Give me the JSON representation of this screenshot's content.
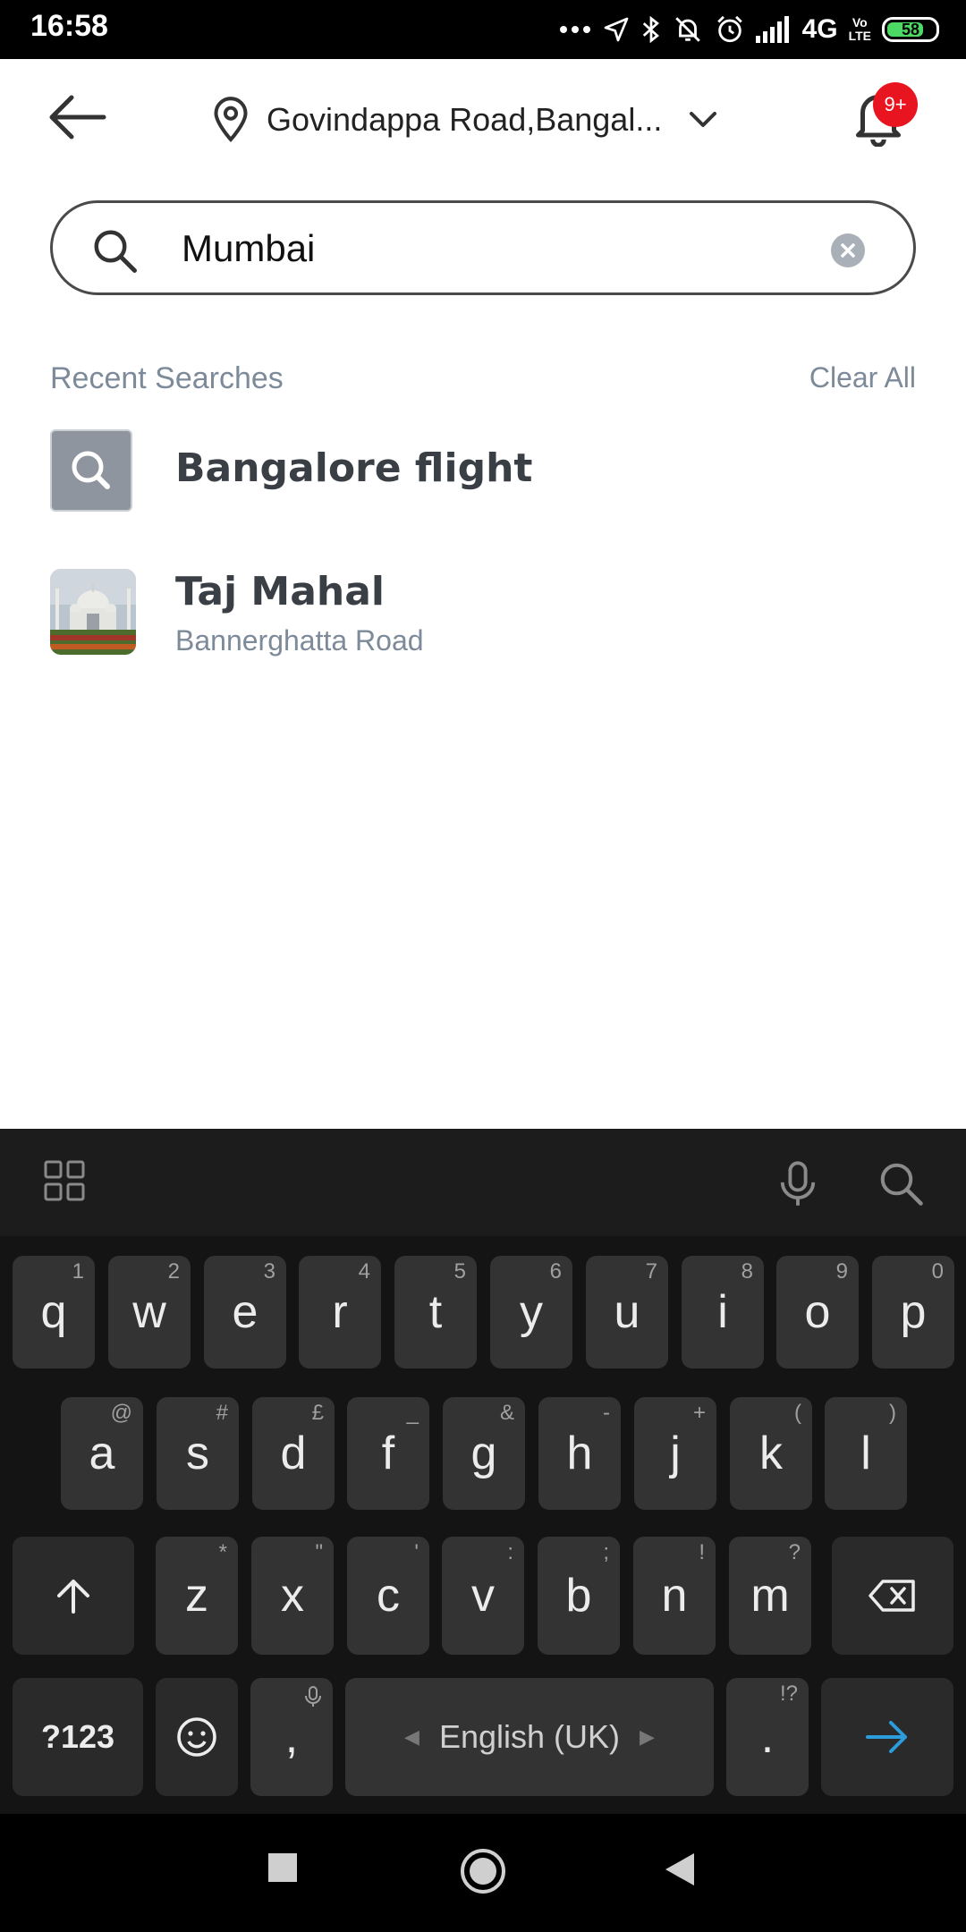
{
  "status_bar": {
    "time": "16:58",
    "network": "4G",
    "volte_top": "Vo",
    "volte_bottom": "LTE",
    "battery": "58"
  },
  "header": {
    "location": "Govindappa Road,Bangal...",
    "notification_badge": "9+"
  },
  "search": {
    "value": "Mumbai",
    "placeholder": ""
  },
  "recent": {
    "title": "Recent Searches",
    "clear_all": "Clear All",
    "items": [
      {
        "title": "Bangalore flight",
        "icon": "search-icon"
      },
      {
        "title": "Taj Mahal",
        "subtitle": "Bannerghatta Road",
        "icon": "taj-mahal-thumbnail"
      }
    ]
  },
  "keyboard": {
    "row1": [
      {
        "k": "q",
        "h": "1"
      },
      {
        "k": "w",
        "h": "2"
      },
      {
        "k": "e",
        "h": "3"
      },
      {
        "k": "r",
        "h": "4"
      },
      {
        "k": "t",
        "h": "5"
      },
      {
        "k": "y",
        "h": "6"
      },
      {
        "k": "u",
        "h": "7"
      },
      {
        "k": "i",
        "h": "8"
      },
      {
        "k": "o",
        "h": "9"
      },
      {
        "k": "p",
        "h": "0"
      }
    ],
    "row2": [
      {
        "k": "a",
        "h": "@"
      },
      {
        "k": "s",
        "h": "#"
      },
      {
        "k": "d",
        "h": "£"
      },
      {
        "k": "f",
        "h": "_"
      },
      {
        "k": "g",
        "h": "&"
      },
      {
        "k": "h",
        "h": "-"
      },
      {
        "k": "j",
        "h": "+"
      },
      {
        "k": "k",
        "h": "("
      },
      {
        "k": "l",
        "h": ")"
      }
    ],
    "row3": [
      {
        "k": "z",
        "h": "*"
      },
      {
        "k": "x",
        "h": "\""
      },
      {
        "k": "c",
        "h": "'"
      },
      {
        "k": "v",
        "h": ":"
      },
      {
        "k": "b",
        "h": ";"
      },
      {
        "k": "n",
        "h": "!"
      },
      {
        "k": "m",
        "h": "?"
      }
    ],
    "symbols_label": "?123",
    "comma": ",",
    "period": ".",
    "period_hint": "!?",
    "space_label": "English (UK)",
    "enter_color": "#2d9cdb"
  }
}
